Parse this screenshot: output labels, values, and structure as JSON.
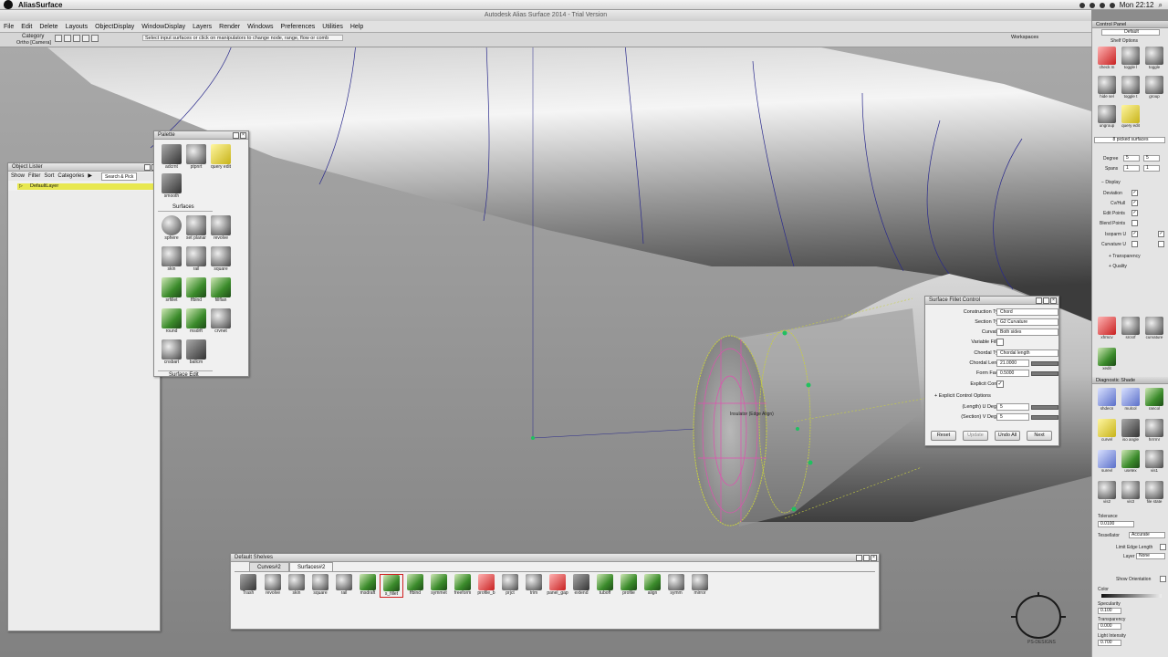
{
  "mac_menu": {
    "app_name": "AliasSurface",
    "clock": "Mon 22:12"
  },
  "window": {
    "title": "Autodesk Alias Surface 2014  -  Trial Version"
  },
  "menubar": {
    "items": [
      "File",
      "Edit",
      "Delete",
      "Layouts",
      "ObjectDisplay",
      "WindowDisplay",
      "Layers",
      "Render",
      "Windows",
      "Preferences",
      "Utilities",
      "Help"
    ]
  },
  "statusbar": {
    "category": "Category",
    "camera": "Ortho [Camera]",
    "prompt": "Select input surfaces or click on manipulators to change node, range, flow or comb",
    "workspaces": "Workspaces"
  },
  "object_lister": {
    "title": "Object Lister",
    "menu": [
      "Show",
      "Filter",
      "Sort",
      "Categories"
    ],
    "search_placeholder": "Search & Pick",
    "layer": "DefaultLayer"
  },
  "palette": {
    "title": "Palette",
    "top_tools": [
      "adcrnt",
      "ptpnrt",
      "query edit",
      "smooth"
    ],
    "section": "Surfaces",
    "surface_tools": [
      "sphere",
      "set planar",
      "revolve",
      "skin",
      "rail",
      "square",
      "srfillet",
      "ffblnd",
      "fillflan",
      "round",
      "msdrft",
      "crvnet",
      "cnsbart",
      "ballcm"
    ],
    "footer": "Surface Edit"
  },
  "fillet_control": {
    "title": "Surface Fillet Control",
    "rows": [
      {
        "label": "Construction Type",
        "value": "Chord"
      },
      {
        "label": "Section Type",
        "value": "G2 Curvature"
      },
      {
        "label": "Curvature",
        "value": "Both sides"
      },
      {
        "label": "Variable Fillets",
        "value": ""
      },
      {
        "label": "Chordal Type",
        "value": "Chordal length"
      },
      {
        "label": "Chordal Length",
        "value": "21.0000"
      },
      {
        "label": "Form Factor",
        "value": "0.5000"
      },
      {
        "label": "Explicit Control",
        "value": "✓"
      }
    ],
    "subsection": "Explicit Control Options",
    "sub_rows": [
      {
        "label": "(Length) U Degree",
        "value": "5"
      },
      {
        "label": "(Section) V Degree",
        "value": "5"
      }
    ],
    "buttons": [
      "Reset",
      "Update",
      "Undo All",
      "Next"
    ]
  },
  "viewport_labels": {
    "caption": "Insulator (Edge Align)"
  },
  "shelves": {
    "title": "Default Shelves",
    "tabs": [
      "Curves#2",
      "Surfaces#2"
    ],
    "tools": [
      "Trash",
      "revolve",
      "skin",
      "square",
      "rail",
      "msdraft",
      "s_fillet",
      "ffblnd",
      "symmet",
      "freeform",
      "profile_b",
      "prjct",
      "trim",
      "panel_gap",
      "extend",
      "tuboff",
      "profile",
      "align",
      "symm",
      "mirror"
    ]
  },
  "control_panel": {
    "title": "Control Panel",
    "mode": "Default",
    "shelf": "Shelf Options",
    "tools": [
      "check m",
      "toggle l",
      "toggle",
      "hide sel",
      "toggle t",
      "group",
      "ungroup",
      "query edit"
    ],
    "picked": "8 picked surfaces",
    "degree_label": "Degree",
    "degree_u": "5",
    "degree_v": "5",
    "spans_label": "Spans",
    "spans_u": "1",
    "spans_v": "1",
    "display_label": "Display",
    "display_items": [
      "Deviation",
      "Cv/Hull",
      "Edit Points",
      "Blend Points",
      "Isoparm U",
      "Curvature U"
    ],
    "transparency": "Transparency",
    "quality": "Quality",
    "extra_tools": [
      "xfrmcv",
      "srcsrf",
      "curvature",
      "xedit"
    ]
  },
  "diagnostic": {
    "title": "Diagnostic Shade",
    "tools": [
      "shdecn",
      "mulcol",
      "rancol",
      "curvel",
      "iso angle",
      "hrrrmr",
      "surevl",
      "usetex",
      "vis1",
      "vis2",
      "vis3",
      "file state"
    ],
    "tolerance_label": "Tolerance",
    "tolerance": "0.0100",
    "tessellator_label": "Tessellator",
    "tessellator": "Accurate",
    "limit_edge": "Limit Edge Length",
    "layer_label": "Layer",
    "layer": "None",
    "show_orientation": "Show Orientation",
    "color_label": "Color",
    "specularity_label": "Specularity",
    "specularity": "0.100",
    "transparency_label": "Transparency",
    "transparency": "0.000",
    "light_label": "Light Intensity",
    "light": "0.700"
  },
  "watermark": {
    "text": "PS-DESIGNS"
  },
  "colors": {
    "accent": "#2a2a8c",
    "selection": "#e050b0",
    "highlight": "#c8d040",
    "cv": "#20c060"
  }
}
